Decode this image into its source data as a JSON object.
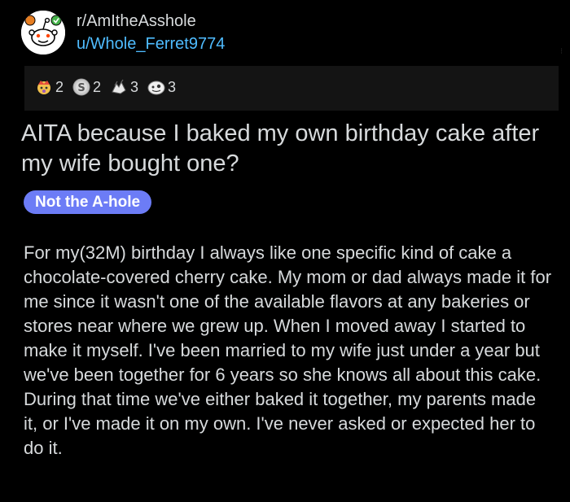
{
  "post": {
    "subreddit": "r/AmItheAsshole",
    "username": "u/Whole_Ferret9774",
    "title": "AITA because I baked my own birthday cake after my wife bought one?",
    "flair": "Not the A-hole",
    "body": "For my(32M) birthday I always like one specific kind of cake a chocolate-covered cherry cake. My mom or dad always made it for me since it wasn't one of the available flavors at any bakeries or stores near where we grew up. When I moved away I started to make it myself. I've been married to my wife just under a year but we've been together for 6 years so she knows all about this cake. During that time we've either baked it together, my parents made it, or I've made it on my own. I've never asked or expected her to do it."
  },
  "awards": [
    {
      "icon": "crown-award-icon",
      "count": "2"
    },
    {
      "icon": "silver-award-icon",
      "count": "2"
    },
    {
      "icon": "hands-award-icon",
      "count": "3"
    },
    {
      "icon": "face-award-icon",
      "count": "3"
    }
  ],
  "colors": {
    "background": "#000000",
    "panel": "#141414",
    "text": "#d7dadc",
    "username": "#4fbcff",
    "flair": "#6c7cf6"
  }
}
